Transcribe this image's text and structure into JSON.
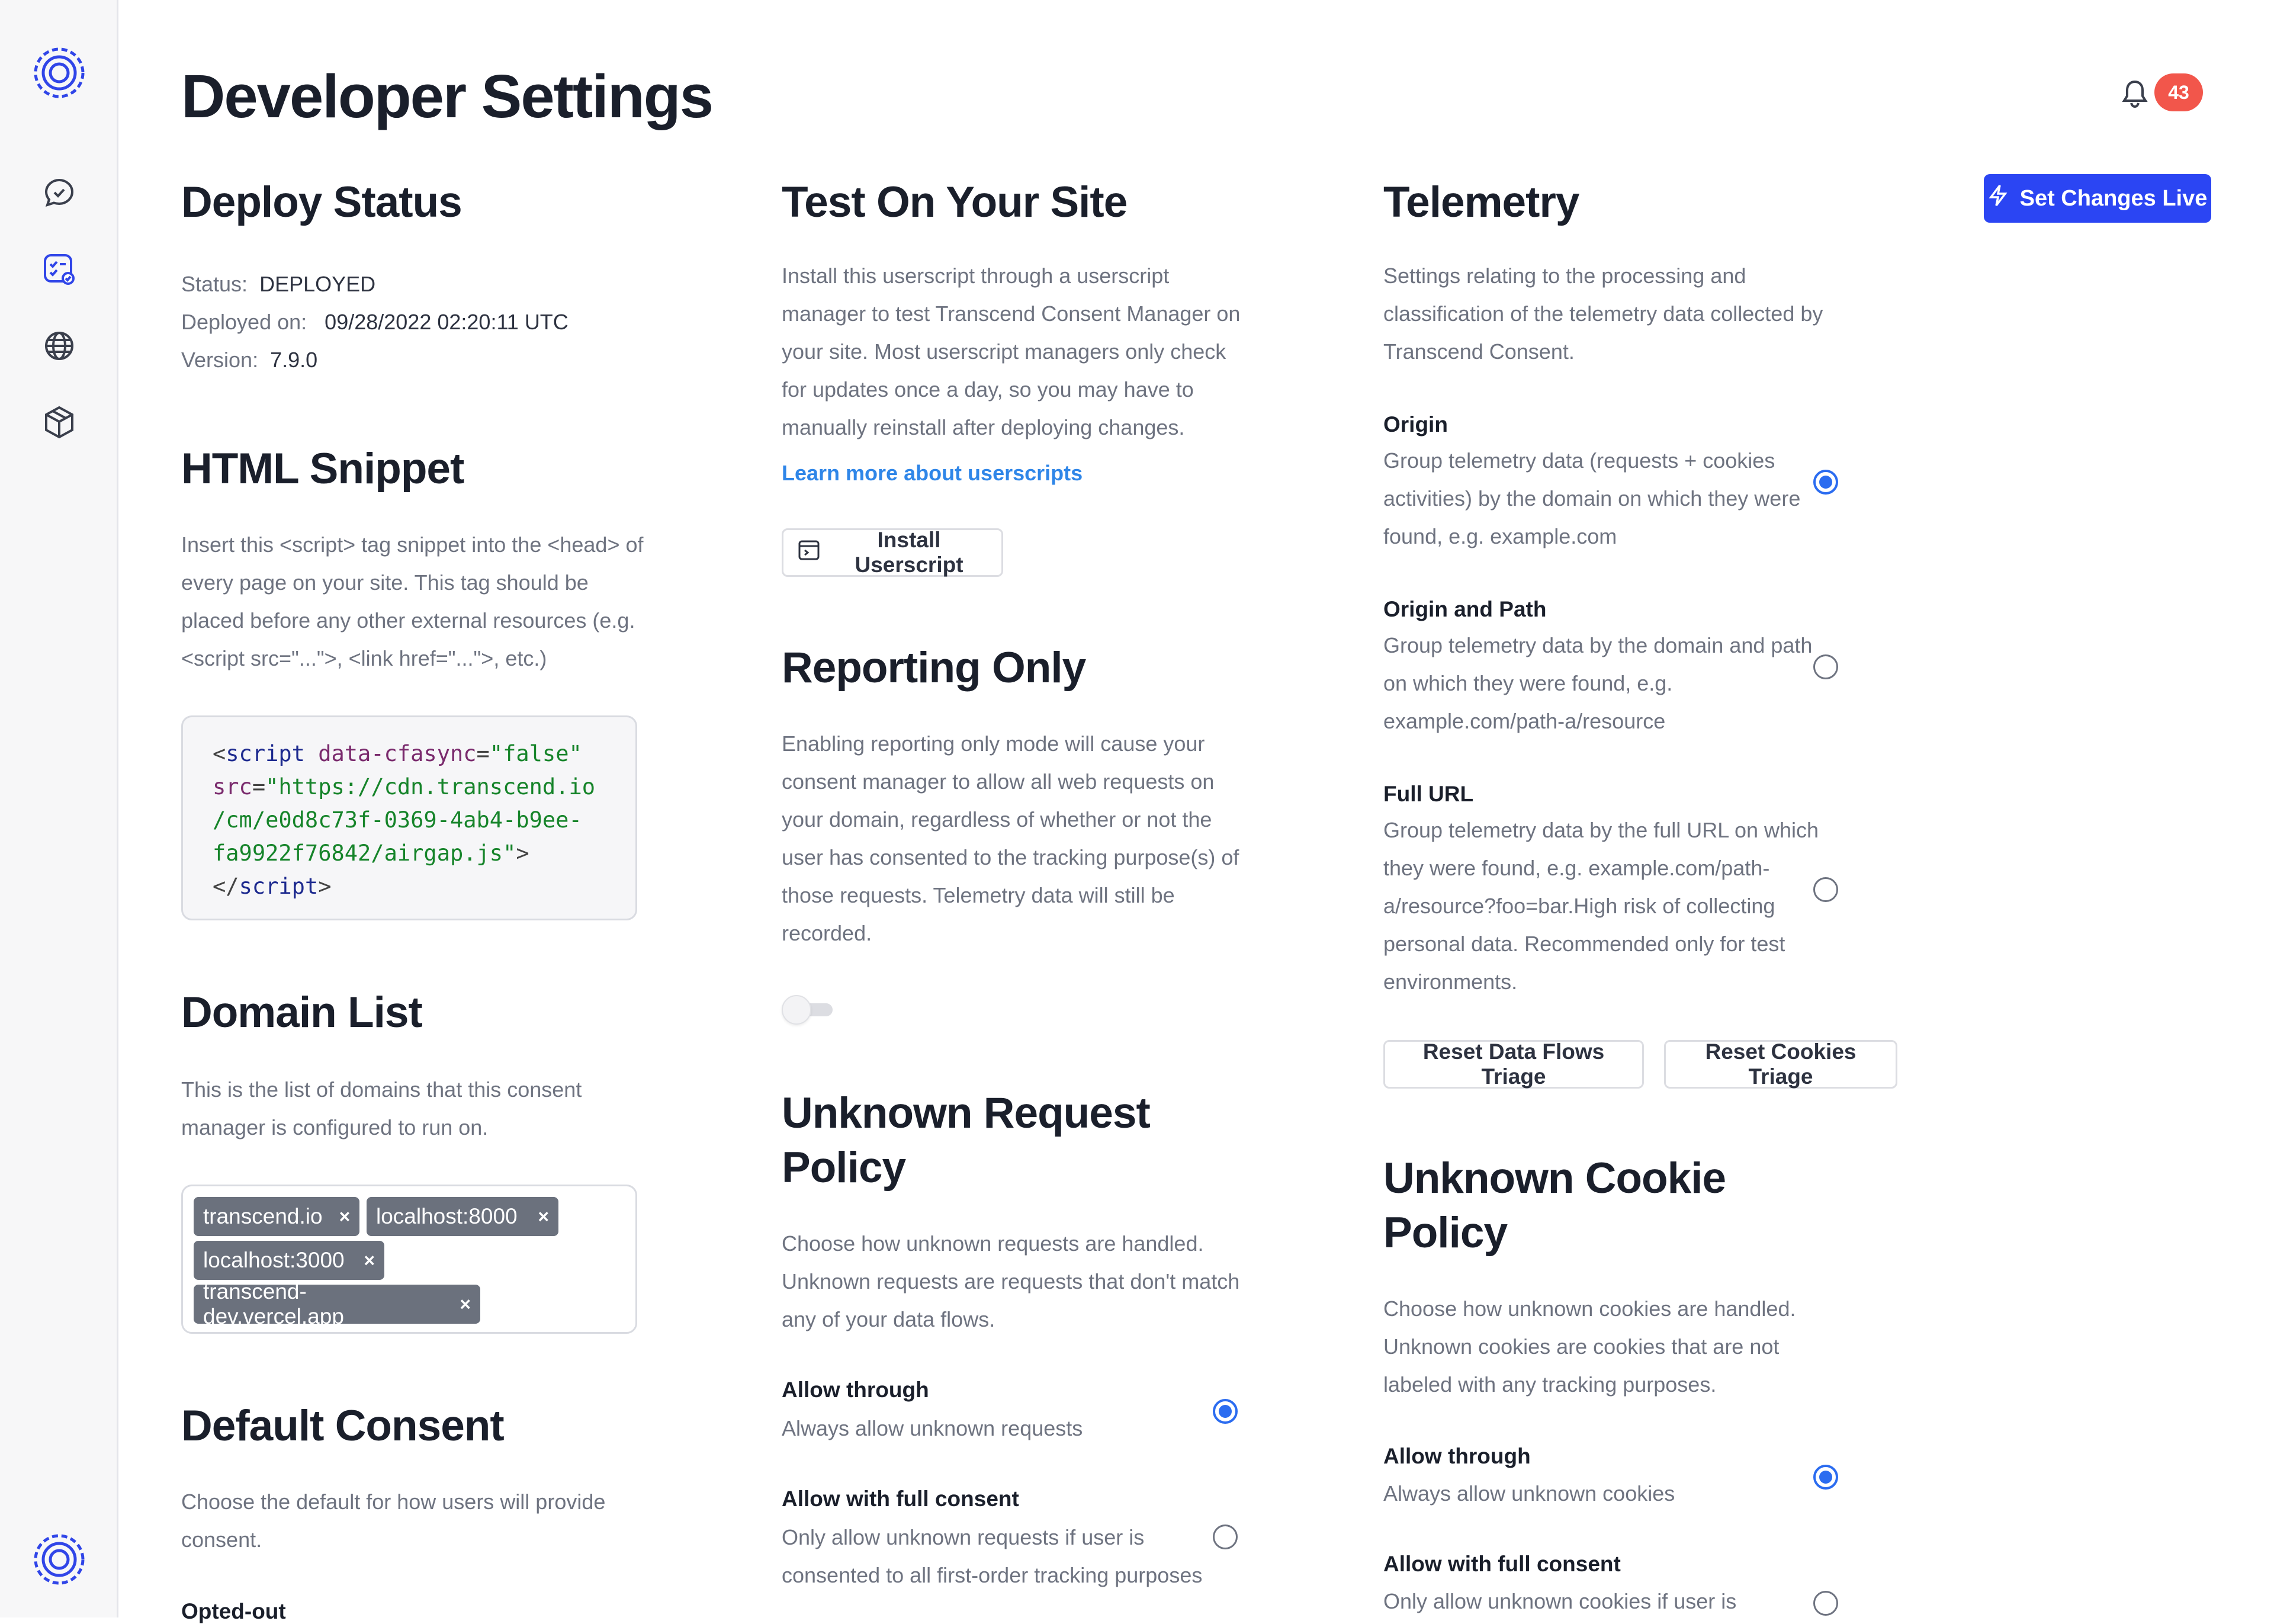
{
  "page": {
    "title": "Developer Settings"
  },
  "header": {
    "notification_count": "43",
    "set_live_label": "Set Changes Live"
  },
  "sidebar": {
    "icons": [
      "logo-icon",
      "chat-icon",
      "consent-icon",
      "globe-icon",
      "package-icon"
    ],
    "bottom_icon": "logo-icon"
  },
  "deploy_status": {
    "heading": "Deploy Status",
    "status_label": "Status:",
    "status_value": "DEPLOYED",
    "deployed_label": "Deployed on:",
    "deployed_value": "09/28/2022 02:20:11 UTC",
    "version_label": "Version:",
    "version_value": "7.9.0"
  },
  "html_snippet": {
    "heading": "HTML Snippet",
    "lines": [
      "Insert this <script> tag snippet into the <head> of",
      "every page on your site. This tag should be",
      "placed before any other external resources (e.g.",
      "<script src=\"...\">, <link href=\"...\">, etc.)"
    ],
    "code": {
      "open": "<",
      "tag": "script",
      "attr1": "data-cfasync",
      "eq": "=",
      "val1": "\"false\"",
      "attr2": "src",
      "val2a": "\"https://cdn.transcend.io",
      "val2b": "/cm/e0d8c73f-0369-4ab4-b9ee-",
      "val2c": "fa9922f76842/airgap.js\"",
      "close_gt": ">",
      "end_open": "</",
      "end_tag": "script",
      "end_gt": ">"
    }
  },
  "domain_list": {
    "heading": "Domain List",
    "lines": [
      "This is the list of domains that this consent",
      "manager is configured to run on."
    ],
    "domains": [
      "transcend.io",
      "localhost:8000",
      "localhost:3000",
      "transcend-dev.vercel.app"
    ],
    "remove_glyph": "×"
  },
  "default_consent": {
    "heading": "Default Consent",
    "lines": [
      "Choose the default for how users will provide",
      "consent."
    ],
    "first_option": "Opted-out"
  },
  "test_site": {
    "heading": "Test On Your Site",
    "lines": [
      "Install this userscript through a userscript",
      "manager to test Transcend Consent Manager on",
      "your site. Most userscript managers only check",
      "for updates once a day, so you may have to",
      "manually reinstall after deploying changes."
    ],
    "link": "Learn more about userscripts",
    "install_label": "Install Userscript"
  },
  "reporting_only": {
    "heading": "Reporting Only",
    "lines": [
      "Enabling reporting only mode will cause your",
      "consent manager to allow all web requests on",
      "your domain, regardless of whether or not the",
      "user has consented to the tracking purpose(s) of",
      "those requests. Telemetry data will still be",
      "recorded."
    ],
    "enabled": false
  },
  "unknown_request": {
    "heading1": "Unknown Request",
    "heading2": "Policy",
    "lines": [
      "Choose how unknown requests are handled.",
      "Unknown requests are requests that don't match",
      "any of your data flows."
    ],
    "options": [
      {
        "title": "Allow through",
        "lines": [
          "Always allow unknown requests"
        ],
        "selected": true
      },
      {
        "title": "Allow with full consent",
        "lines": [
          "Only allow unknown requests if user is",
          "consented to all first-order tracking purposes"
        ],
        "selected": false
      }
    ]
  },
  "telemetry": {
    "heading": "Telemetry",
    "lines": [
      "Settings relating to the processing and",
      "classification of the telemetry data collected by",
      "Transcend Consent."
    ],
    "options": [
      {
        "title": "Origin",
        "lines": [
          "Group telemetry data (requests + cookies",
          "activities) by the domain on which they were",
          "found, e.g. example.com"
        ],
        "selected": true
      },
      {
        "title": "Origin and Path",
        "lines": [
          "Group telemetry data by the domain and path",
          "on which they were found, e.g.",
          "example.com/path-a/resource"
        ],
        "selected": false
      },
      {
        "title": "Full URL",
        "lines": [
          "Group telemetry data by the full URL on which",
          "they were found, e.g. example.com/path-",
          "a/resource?foo=bar.High risk of collecting",
          "personal data. Recommended only for test",
          "environments."
        ],
        "selected": false
      }
    ],
    "reset_flows": "Reset Data Flows Triage",
    "reset_cookies": "Reset Cookies Triage"
  },
  "unknown_cookie": {
    "heading1": "Unknown Cookie",
    "heading2": "Policy",
    "lines": [
      "Choose how unknown cookies are handled.",
      "Unknown cookies are cookies that are not",
      "labeled with any tracking purposes."
    ],
    "options": [
      {
        "title": "Allow through",
        "lines": [
          "Always allow unknown cookies"
        ],
        "selected": true
      },
      {
        "title": "Allow with full consent",
        "lines": [
          "Only allow unknown cookies if user is"
        ],
        "selected": false
      }
    ]
  },
  "colors": {
    "accent": "#2b45f3",
    "radio": "#2b6cf0",
    "badge": "#f2564b",
    "link": "#2f86e8",
    "chip": "#6b717d"
  }
}
